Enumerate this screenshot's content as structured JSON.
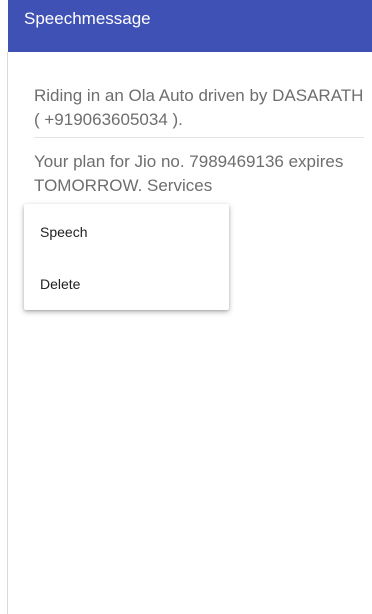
{
  "app_bar": {
    "title": "Speechmessage"
  },
  "messages": [
    {
      "text": "Riding in an Ola Auto driven by DASARATH ( +919063605034 )."
    },
    {
      "text": "Your plan for Jio no. 7989469136 expires TOMORROW. Services"
    }
  ],
  "context_menu": {
    "items": [
      {
        "label": "Speech"
      },
      {
        "label": "Delete"
      }
    ]
  },
  "colors": {
    "app_bar": "#3f51b5",
    "app_title": "#ffffff",
    "message_text": "#6e6e6e",
    "menu_text": "#222222",
    "background": "#ffffff"
  }
}
